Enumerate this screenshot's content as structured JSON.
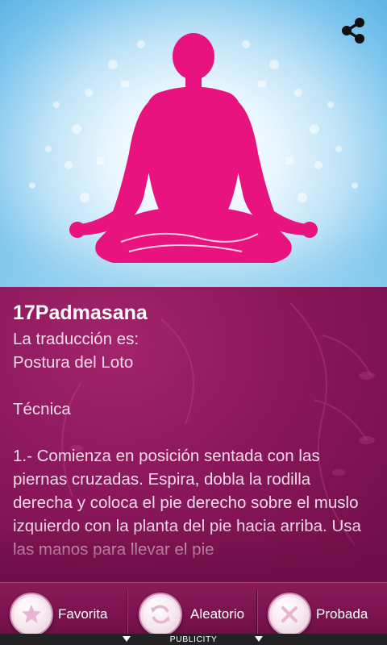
{
  "exercise": {
    "title": "17Padmasana",
    "body": "La traducción es:\nPostura del Loto\n\nTécnica\n\n1.- Comienza en posición sentada con las piernas cruzadas. Espira, dobla la rodilla derecha y coloca el pie derecho sobre el muslo izquierdo con la planta del pie hacia arriba. Usa las manos para llevar el pie"
  },
  "header": {
    "share_icon": "share-icon",
    "illustration": "meditating-lotus-silhouette"
  },
  "bottom_bar": {
    "items": [
      {
        "label": "Favorita",
        "icon": "star-icon"
      },
      {
        "label": "Aleatorio",
        "icon": "refresh-icon"
      },
      {
        "label": "Probada",
        "icon": "close-icon"
      }
    ]
  },
  "ad_bar": {
    "label": "PUBLICITY"
  },
  "colors": {
    "accent": "#e8137f",
    "panel": "#8a175a",
    "sky": "#7fc6ee"
  }
}
